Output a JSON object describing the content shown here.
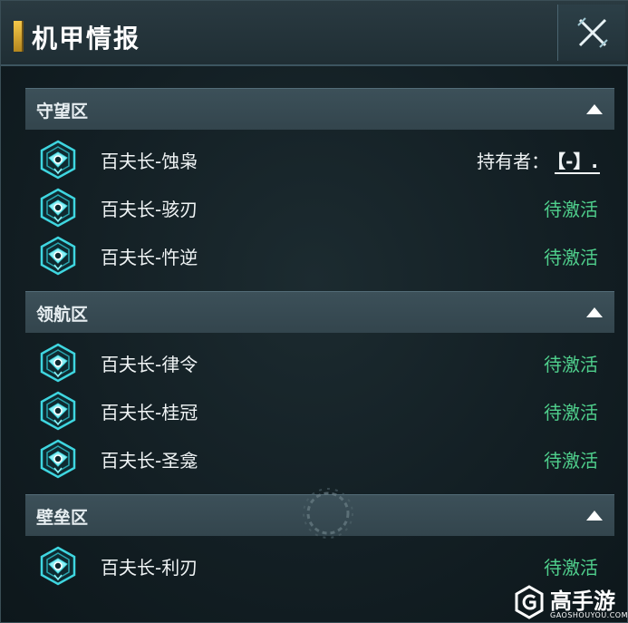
{
  "window": {
    "title": "机甲情报"
  },
  "sections": [
    {
      "title": "守望区",
      "items": [
        {
          "name": "百夫长-蚀枭",
          "status": "",
          "holder_label": "持有者：",
          "holder_value": "【-】."
        },
        {
          "name": "百夫长-骇刃",
          "status": "待激活"
        },
        {
          "name": "百夫长-忤逆",
          "status": "待激活"
        }
      ]
    },
    {
      "title": "领航区",
      "items": [
        {
          "name": "百夫长-律令",
          "status": "待激活"
        },
        {
          "name": "百夫长-桂冠",
          "status": "待激活"
        },
        {
          "name": "百夫长-圣龛",
          "status": "待激活"
        }
      ]
    },
    {
      "title": "壁垒区",
      "items": [
        {
          "name": "百夫长-利刃",
          "status": "待激活"
        }
      ]
    }
  ],
  "watermark": {
    "name": "高手游",
    "sub": "GAOSHOUYOU.COM"
  },
  "colors": {
    "accent_gold": "#f5c84a",
    "status_green": "#4fcf8c",
    "icon_cyan": "#3fd6e0"
  },
  "icons": {
    "close": "close-x-icon",
    "collapse": "chevron-up-icon",
    "mech": "mech-emblem-icon"
  }
}
